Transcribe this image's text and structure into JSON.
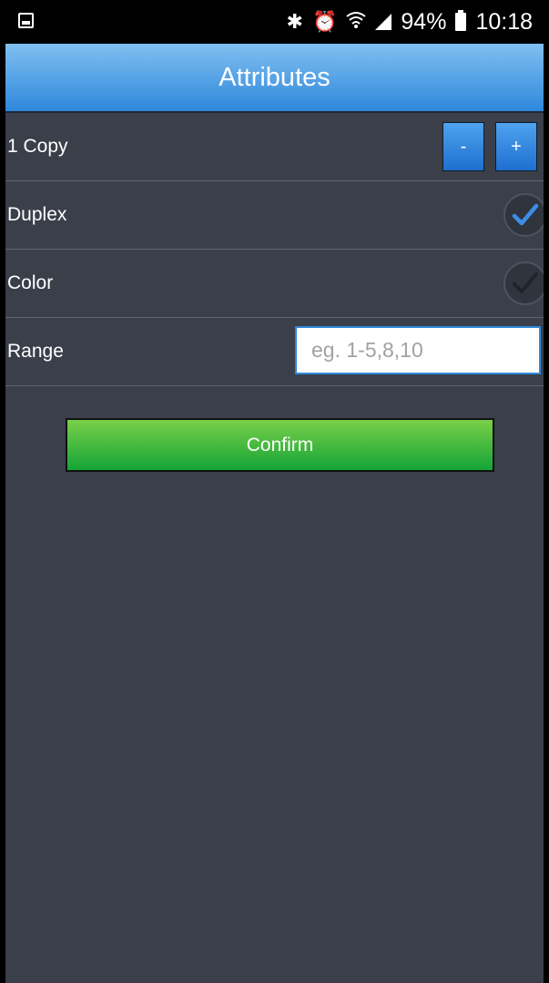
{
  "status_bar": {
    "battery": "94%",
    "time": "10:18",
    "icons": [
      "gallery-icon",
      "bluetooth-icon",
      "alarm-icon",
      "wifi-icon",
      "signal-icon",
      "battery-icon"
    ]
  },
  "header": {
    "title": "Attributes"
  },
  "copies": {
    "label": "1 Copy",
    "minus_label": "-",
    "plus_label": "+"
  },
  "duplex": {
    "label": "Duplex",
    "checked": true
  },
  "color": {
    "label": "Color",
    "checked": false
  },
  "range": {
    "label": "Range",
    "placeholder": "eg. 1-5,8,10",
    "value": ""
  },
  "confirm": {
    "label": "Confirm"
  },
  "colors": {
    "accent": "#2f88dc",
    "background": "#3a3f4a",
    "confirm": "#14a437"
  }
}
